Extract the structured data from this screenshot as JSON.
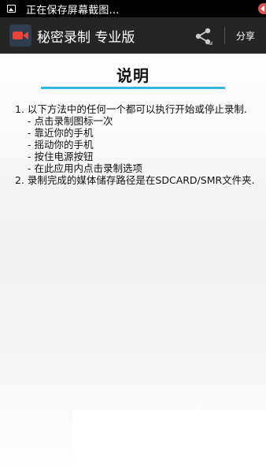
{
  "status_bar": {
    "text": "正在保存屏幕截图..."
  },
  "action_bar": {
    "title": "秘密录制 专业版",
    "share_label": "分享"
  },
  "content": {
    "title": "说明",
    "instructions": [
      {
        "text": "1. 以下方法中的任何一个都可以执行开始或停止录制.",
        "indent": false
      },
      {
        "text": "- 点击录制图标一次",
        "indent": true
      },
      {
        "text": "- 靠近你的手机",
        "indent": true
      },
      {
        "text": "- 摇动你的手机",
        "indent": true
      },
      {
        "text": "- 按住电源按钮",
        "indent": true
      },
      {
        "text": "- 在此应用内点击录制选项",
        "indent": true
      },
      {
        "text": "2. 录制完成的媒体储存路径是在SDCARD/SMR文件夹.",
        "indent": false
      }
    ]
  },
  "colors": {
    "accent": "#33b5e5",
    "action_bar": "#252525",
    "record_icon": "#e8453c"
  },
  "icons": {
    "status": "image-icon",
    "app": "camera-icon",
    "share": "share-icon"
  }
}
